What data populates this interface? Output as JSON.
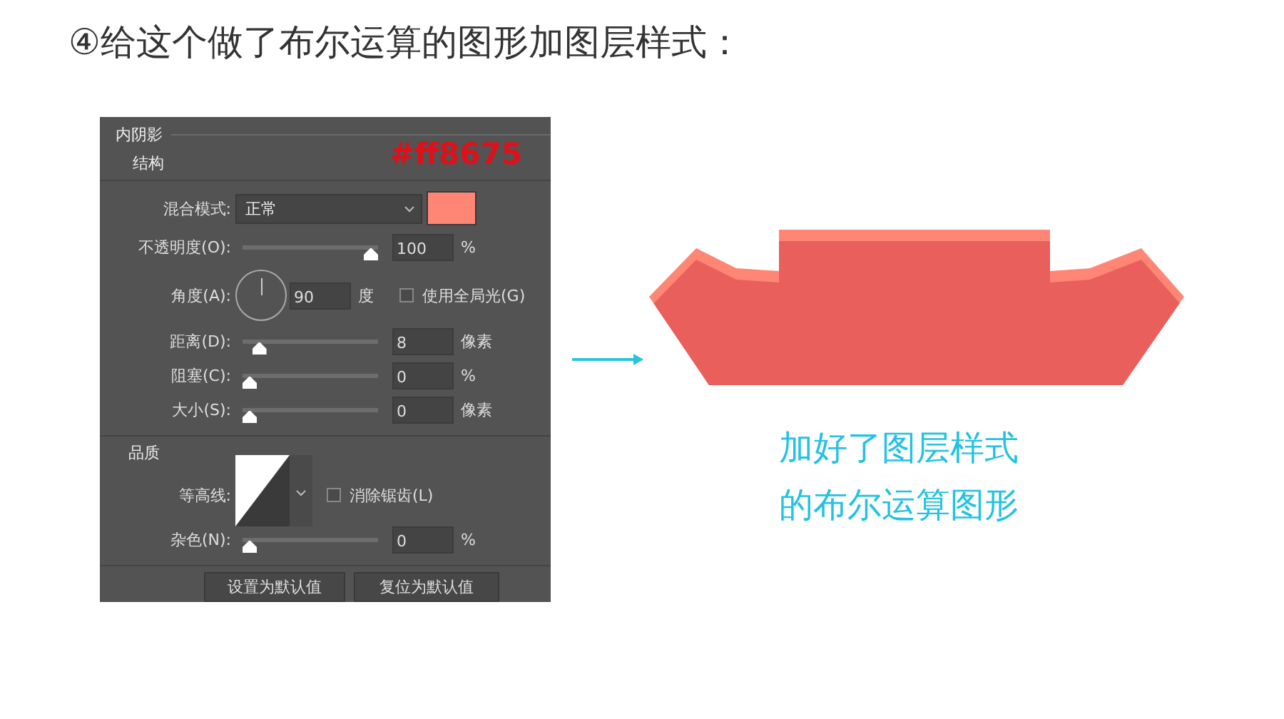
{
  "heading": "④给这个做了布尔运算的图形加图层样式：",
  "dialog": {
    "title": "内阴影",
    "section": "结构",
    "color_note": "#ff8675",
    "rows": [
      {
        "kind": "dropdown",
        "label": "混合模式:",
        "value": "正常"
      },
      {
        "kind": "slider",
        "label": "不透明度(O):",
        "level": 1,
        "value": "100",
        "unit": "%"
      },
      {
        "kind": "angle",
        "label": "角度(A):",
        "value": "90",
        "unit": "度",
        "checkbox_label": "使用全局光(G)",
        "checked": false
      },
      {
        "kind": "slider",
        "label": "距离(D):",
        "level": 0.08,
        "value": "8",
        "unit": "像素"
      },
      {
        "kind": "slider",
        "label": "阻塞(C):",
        "level": 0,
        "value": "0",
        "unit": "%"
      },
      {
        "kind": "slider",
        "label": "大小(S):",
        "level": 0,
        "value": "0",
        "unit": "像素"
      }
    ],
    "quality_section": "品质",
    "quality_rows": [
      {
        "kind": "contour",
        "label": "等高线:",
        "checkbox_label": "消除锯齿(L)",
        "checked": false
      },
      {
        "kind": "slider",
        "label": "杂色(N):",
        "level": 0,
        "value": "0",
        "unit": "%"
      }
    ],
    "buttons": [
      "设置为默认值",
      "复位为默认值"
    ]
  },
  "caption": [
    "加好了图层样式",
    "的布尔运算图形"
  ]
}
